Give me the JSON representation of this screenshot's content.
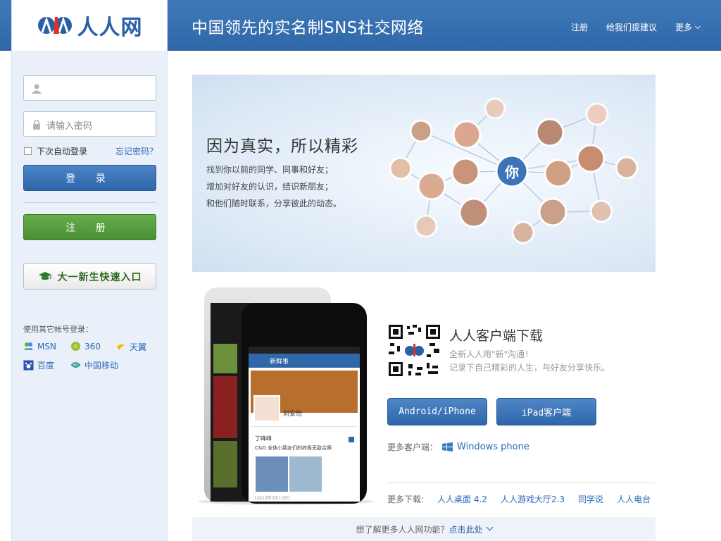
{
  "header": {
    "title": "中国领先的实名制SNS社交网络",
    "nav": [
      "注册",
      "给我们提建议",
      "更多"
    ]
  },
  "logo": {
    "text": "人人网"
  },
  "login": {
    "username_placeholder": "",
    "password_placeholder": "请输入密码",
    "remember_label": "下次自动登录",
    "forgot_label": "忘记密码？",
    "login_button": "登 录",
    "register_button": "注 册",
    "freshman_button": "大一新生快速入口",
    "other_login_label": "使用其它帐号登录：",
    "providers": [
      "MSN",
      "360",
      "天翼",
      "百度",
      "中国移动"
    ]
  },
  "banner": {
    "title": "因为真实，所以精彩",
    "lines": [
      "找到你以前的同学、同事和好友；",
      "增加对好友的认识，结识新朋友；",
      "和他们随时联系，分享彼此的动态。"
    ],
    "center_label": "你"
  },
  "client": {
    "title": "人人客户端下载",
    "sub1": "全新人人用\"新\"沟通！",
    "sub2": "记录下自己精彩的人生，与好友分享快乐。",
    "android_button": "Android/iPhone",
    "ipad_button": "iPad客户端",
    "more_client_label": "更多客户端：",
    "windows_phone": "Windows phone",
    "more_download_label": "更多下载:",
    "downloads": [
      "人人桌面 4.2",
      "人人游戏大厅2.3",
      "同学说",
      "人人电台"
    ]
  },
  "phone": {
    "feed_title": "新鲜事",
    "user_name": "刘安怡",
    "post_author": "丁峰峰",
    "post_text": "C&D 全体小朋友们的终极无敌合照",
    "date": "[2013年3月13日]"
  },
  "footer": {
    "text": "想了解更多人人网功能？",
    "link": "点击此处"
  },
  "colors": {
    "brand_blue": "#2f67a8",
    "register_green": "#4b8f34",
    "link_blue": "#2a6ab5"
  }
}
